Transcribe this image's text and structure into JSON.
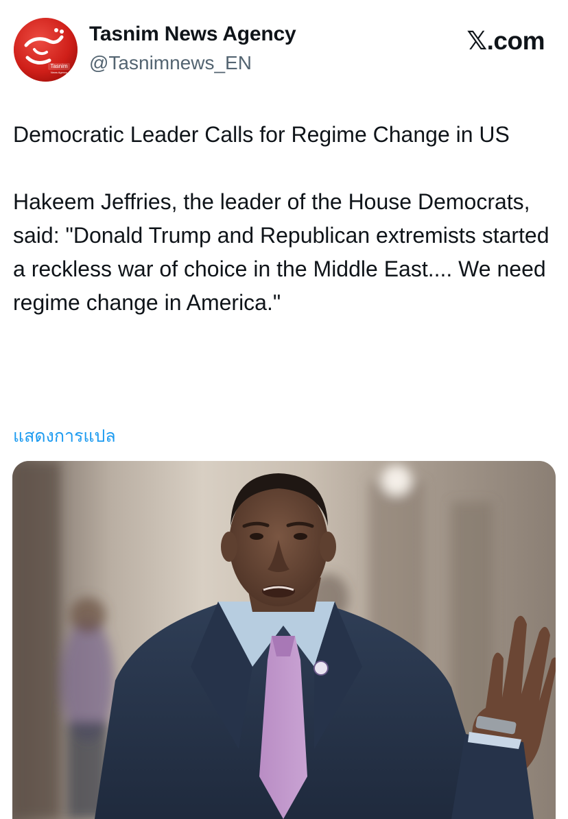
{
  "header": {
    "display_name": "Tasnim News Agency",
    "handle": "@Tasnimnews_EN",
    "source_site": "X.com",
    "source_x": "𝕏",
    "source_suffix": ".com",
    "avatar_logo_text": "Tasnim",
    "avatar_logo_subtext": "News Agency"
  },
  "tweet": {
    "headline": "Democratic Leader Calls for Regime Change in US",
    "body": "Hakeem Jeffries, the leader of the House Democrats, said: \"Donald Trump and Republican extremists started a reckless war of choice in the Middle East.... We need regime change in America.\"",
    "translate_label": "แสดงการแปล"
  },
  "media": {
    "type": "photo",
    "description_icon": "person-photo"
  },
  "colors": {
    "text": "#0f1419",
    "secondary": "#536471",
    "link": "#1d9bf0",
    "avatar_red": "#d0211b"
  }
}
